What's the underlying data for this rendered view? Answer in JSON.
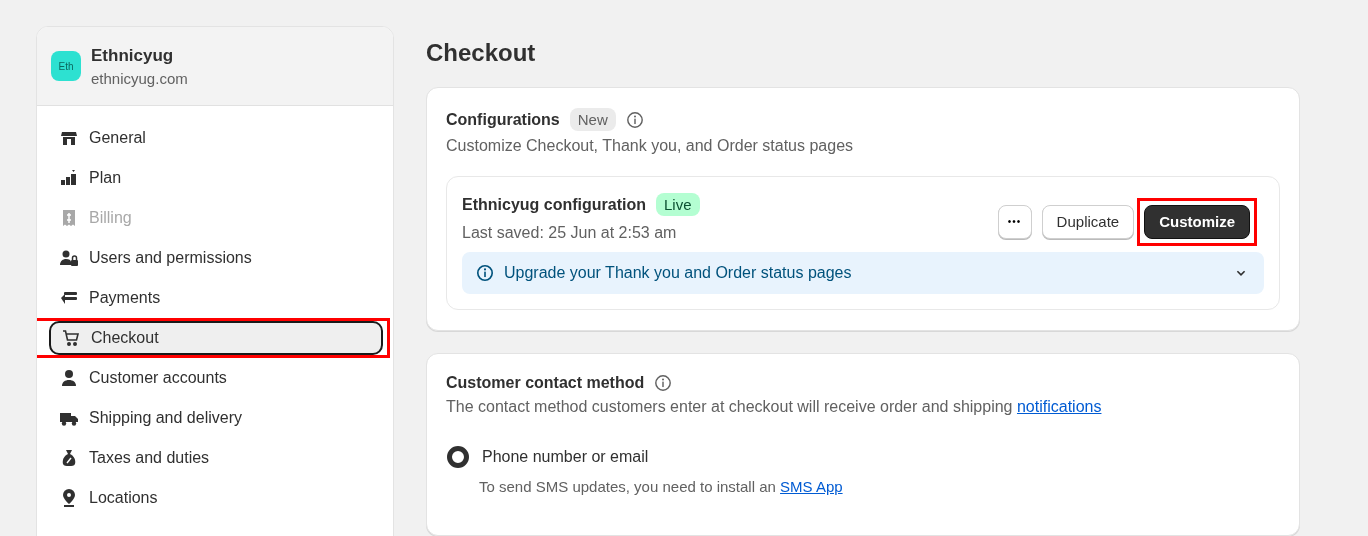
{
  "store": {
    "avatar": "Eth",
    "name": "Ethnicyug",
    "domain": "ethnicyug.com"
  },
  "nav": [
    {
      "label": "General",
      "selected": false,
      "disabled": false,
      "highlighted": false
    },
    {
      "label": "Plan",
      "selected": false,
      "disabled": false,
      "highlighted": false
    },
    {
      "label": "Billing",
      "selected": false,
      "disabled": true,
      "highlighted": false
    },
    {
      "label": "Users and permissions",
      "selected": false,
      "disabled": false,
      "highlighted": false
    },
    {
      "label": "Payments",
      "selected": false,
      "disabled": false,
      "highlighted": false
    },
    {
      "label": "Checkout",
      "selected": true,
      "disabled": false,
      "highlighted": true
    },
    {
      "label": "Customer accounts",
      "selected": false,
      "disabled": false,
      "highlighted": false
    },
    {
      "label": "Shipping and delivery",
      "selected": false,
      "disabled": false,
      "highlighted": false
    },
    {
      "label": "Taxes and duties",
      "selected": false,
      "disabled": false,
      "highlighted": false
    },
    {
      "label": "Locations",
      "selected": false,
      "disabled": false,
      "highlighted": false
    }
  ],
  "page_title": "Checkout",
  "configurations": {
    "title": "Configurations",
    "badge": "New",
    "description": "Customize Checkout, Thank you, and Order status pages",
    "config": {
      "name": "Ethnicyug configuration",
      "status": "Live",
      "last_saved": "Last saved: 25 Jun at 2:53 am",
      "buttons": [
        {
          "kind": "more",
          "label": "•••",
          "highlighted": false
        },
        {
          "kind": "secondary",
          "label": "Duplicate",
          "highlighted": false
        },
        {
          "kind": "primary",
          "label": "Customize",
          "highlighted": true
        }
      ],
      "banner": {
        "text": "Upgrade your Thank you and Order status pages",
        "expanded": false
      }
    }
  },
  "contact": {
    "title": "Customer contact method",
    "description": "The contact method customers enter at checkout will receive order and shipping",
    "link": "notifications",
    "options": [
      {
        "label": "Phone number or email",
        "selected": true,
        "help": "To send SMS updates, you need to install an",
        "help_link": "SMS App"
      }
    ]
  }
}
